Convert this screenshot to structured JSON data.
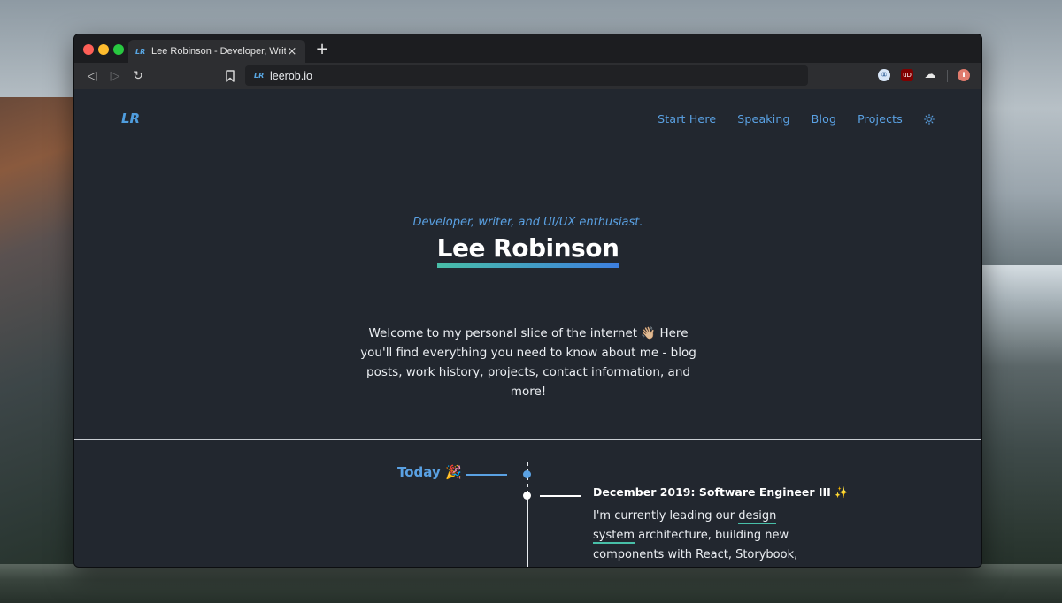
{
  "browser": {
    "tab": {
      "favicon": "LR",
      "title": "Lee Robinson - Developer, Writer",
      "close_glyph": "×"
    },
    "new_tab_glyph": "+",
    "toolbar": {
      "back_glyph": "◁",
      "forward_glyph": "▷",
      "reload_glyph": "↻",
      "bookmark_glyph": "🔖",
      "url_favicon": "LR",
      "url": "leerob.io"
    },
    "extensions": {
      "onepassword": "①",
      "ublock": "uD",
      "cloud": "☁",
      "profile": "⬆"
    }
  },
  "site": {
    "logo": "LR",
    "nav": {
      "start_here": "Start Here",
      "speaking": "Speaking",
      "blog": "Blog",
      "projects": "Projects",
      "theme_icon": "sun-icon"
    },
    "hero": {
      "subtitle": "Developer, writer, and UI/UX enthusiast.",
      "title": "Lee Robinson"
    },
    "intro": {
      "text": "Welcome to my personal slice of the internet 👋🏼  Here you'll find everything you need to know about me - blog posts, work history, projects, contact information, and more!"
    },
    "timeline": {
      "today_label": "Today 🎉",
      "entry": {
        "title": "December 2019: Software Engineer III ✨",
        "body_before": "I'm currently leading our ",
        "body_link": "design system",
        "body_after": " architecture, building new components with React, Storybook, and"
      }
    }
  },
  "colors": {
    "accent": "#5aa1e3",
    "page_bg": "#22272f",
    "underline_start": "#48bfa8",
    "underline_end": "#3d7fe0"
  }
}
